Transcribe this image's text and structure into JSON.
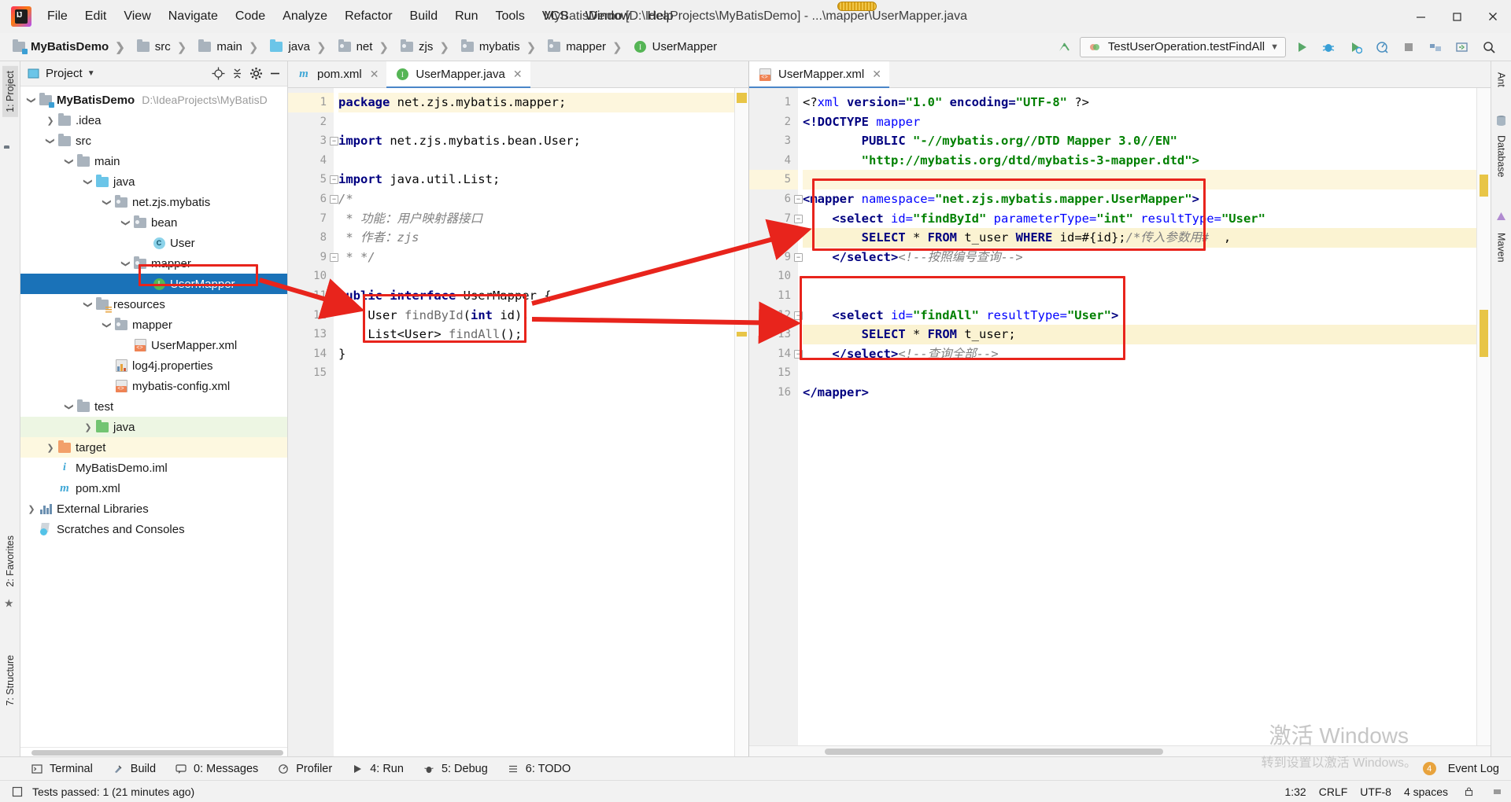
{
  "titlebar": {
    "window_title": "MyBatisDemo [D:\\IdeaProjects\\MyBatisDemo] - ...\\mapper\\UserMapper.java",
    "menus": [
      "File",
      "Edit",
      "View",
      "Navigate",
      "Code",
      "Analyze",
      "Refactor",
      "Build",
      "Run",
      "Tools",
      "VCS",
      "Window",
      "Help"
    ],
    "minimize": "—",
    "maximize": "❐",
    "close": "✕"
  },
  "navbar": {
    "crumbs": [
      {
        "label": "MyBatisDemo",
        "icon": "module-folder-icon"
      },
      {
        "label": "src",
        "icon": "folder-icon"
      },
      {
        "label": "main",
        "icon": "folder-icon"
      },
      {
        "label": "java",
        "icon": "source-folder-icon"
      },
      {
        "label": "net",
        "icon": "package-icon"
      },
      {
        "label": "zjs",
        "icon": "package-icon"
      },
      {
        "label": "mybatis",
        "icon": "package-icon"
      },
      {
        "label": "mapper",
        "icon": "package-icon"
      },
      {
        "label": "UserMapper",
        "icon": "interface-icon"
      }
    ],
    "run_config": "TestUserOperation.testFindAll",
    "buttons": [
      "run-button",
      "debug-button",
      "run-coverage-button",
      "profile-button",
      "stop-button",
      "build-button",
      "update-button",
      "search-button"
    ]
  },
  "leftrail": {
    "tabs": [
      "1: Project",
      "2: Favorites",
      "7: Structure"
    ]
  },
  "rightrail": {
    "tabs": [
      "Ant",
      "Database",
      "Maven"
    ]
  },
  "project_panel": {
    "title": "Project",
    "toolbar_icons": [
      "locate-icon",
      "collapse-all-icon",
      "settings-icon",
      "hide-icon"
    ],
    "tree": [
      {
        "depth": 0,
        "arrow": "down",
        "label": "MyBatisDemo",
        "path": "D:\\IdeaProjects\\MyBatisD",
        "icon": "module-folder-icon",
        "bold": true
      },
      {
        "depth": 1,
        "arrow": "right",
        "label": ".idea",
        "icon": "folder-icon"
      },
      {
        "depth": 1,
        "arrow": "down",
        "label": "src",
        "icon": "folder-icon"
      },
      {
        "depth": 2,
        "arrow": "down",
        "label": "main",
        "icon": "folder-icon"
      },
      {
        "depth": 3,
        "arrow": "down",
        "label": "java",
        "icon": "source-folder-icon"
      },
      {
        "depth": 4,
        "arrow": "down",
        "label": "net.zjs.mybatis",
        "icon": "package-icon"
      },
      {
        "depth": 5,
        "arrow": "down",
        "label": "bean",
        "icon": "package-icon"
      },
      {
        "depth": 6,
        "arrow": "none",
        "label": "User",
        "icon": "class-icon"
      },
      {
        "depth": 5,
        "arrow": "down",
        "label": "mapper",
        "icon": "package-icon"
      },
      {
        "depth": 6,
        "arrow": "none",
        "label": "UserMapper",
        "icon": "interface-icon",
        "selected": true
      },
      {
        "depth": 3,
        "arrow": "down",
        "label": "resources",
        "icon": "resources-folder-icon"
      },
      {
        "depth": 4,
        "arrow": "down",
        "label": "mapper",
        "icon": "package-icon"
      },
      {
        "depth": 5,
        "arrow": "none",
        "label": "UserMapper.xml",
        "icon": "xml-file-icon"
      },
      {
        "depth": 4,
        "arrow": "none",
        "label": "log4j.properties",
        "icon": "properties-file-icon"
      },
      {
        "depth": 4,
        "arrow": "none",
        "label": "mybatis-config.xml",
        "icon": "xml-file-icon"
      },
      {
        "depth": 2,
        "arrow": "down",
        "label": "test",
        "icon": "folder-icon"
      },
      {
        "depth": 3,
        "arrow": "right",
        "label": "java",
        "icon": "test-source-folder-icon",
        "green": true
      },
      {
        "depth": 1,
        "arrow": "right",
        "label": "target",
        "icon": "excluded-folder-icon",
        "yellowish": true
      },
      {
        "depth": 1,
        "arrow": "none",
        "label": "MyBatisDemo.iml",
        "icon": "iml-file-icon"
      },
      {
        "depth": 1,
        "arrow": "none",
        "label": "pom.xml",
        "icon": "maven-file-icon"
      },
      {
        "depth": 0,
        "arrow": "right",
        "label": "External Libraries",
        "icon": "libraries-icon"
      },
      {
        "depth": 0,
        "arrow": "none",
        "label": "Scratches and Consoles",
        "icon": "scratches-icon"
      }
    ]
  },
  "editor_left": {
    "tabs": [
      {
        "label": "pom.xml",
        "icon": "maven-file-icon",
        "active": false
      },
      {
        "label": "UserMapper.java",
        "icon": "interface-icon",
        "active": true
      }
    ],
    "lines": [
      {
        "n": 1,
        "hl": true,
        "fold": null,
        "parts": [
          {
            "t": "package ",
            "c": "kw"
          },
          {
            "t": "net.zjs.mybatis.mapper;",
            "c": "plain"
          }
        ]
      },
      {
        "n": 2,
        "hl": false,
        "fold": null,
        "parts": []
      },
      {
        "n": 3,
        "hl": false,
        "fold": "minus",
        "parts": [
          {
            "t": "import ",
            "c": "kw"
          },
          {
            "t": "net.zjs.mybatis.bean.User;",
            "c": "plain"
          }
        ]
      },
      {
        "n": 4,
        "hl": false,
        "fold": null,
        "parts": []
      },
      {
        "n": 5,
        "hl": false,
        "fold": "minus",
        "parts": [
          {
            "t": "import ",
            "c": "kw"
          },
          {
            "t": "java.util.List;",
            "c": "plain"
          }
        ]
      },
      {
        "n": 6,
        "hl": false,
        "fold": "minus",
        "parts": [
          {
            "t": "/*",
            "c": "doc"
          }
        ]
      },
      {
        "n": 7,
        "hl": false,
        "fold": null,
        "parts": [
          {
            "t": " * 功能：用户映射器接口",
            "c": "doc"
          }
        ]
      },
      {
        "n": 8,
        "hl": false,
        "fold": null,
        "parts": [
          {
            "t": " * 作者：zjs",
            "c": "doc"
          }
        ]
      },
      {
        "n": 9,
        "hl": false,
        "fold": "minus",
        "parts": [
          {
            "t": " * */",
            "c": "doc"
          }
        ]
      },
      {
        "n": 10,
        "hl": false,
        "fold": null,
        "parts": []
      },
      {
        "n": 11,
        "hl": false,
        "fold": null,
        "parts": [
          {
            "t": "public interface ",
            "c": "kw"
          },
          {
            "t": "UserMapper {",
            "c": "plain"
          }
        ]
      },
      {
        "n": 12,
        "hl": false,
        "fold": null,
        "parts": [
          {
            "t": "    User ",
            "c": "plain"
          },
          {
            "t": "findById",
            "c": "meth"
          },
          {
            "t": "(",
            "c": "plain"
          },
          {
            "t": "int",
            "c": "kw"
          },
          {
            "t": " id);",
            "c": "plain"
          }
        ]
      },
      {
        "n": 13,
        "hl": false,
        "fold": null,
        "parts": [
          {
            "t": "    List<User> ",
            "c": "plain"
          },
          {
            "t": "findAll",
            "c": "meth"
          },
          {
            "t": "();",
            "c": "plain"
          }
        ]
      },
      {
        "n": 14,
        "hl": false,
        "fold": null,
        "parts": [
          {
            "t": "}",
            "c": "plain"
          }
        ]
      },
      {
        "n": 15,
        "hl": false,
        "fold": null,
        "parts": []
      }
    ]
  },
  "editor_right": {
    "tabs": [
      {
        "label": "UserMapper.xml",
        "icon": "xml-file-icon",
        "active": true
      }
    ],
    "lines": [
      {
        "n": 1,
        "hl": false,
        "fold": null,
        "parts": [
          {
            "t": "<?",
            "c": "plain"
          },
          {
            "t": "xml ",
            "c": "attr"
          },
          {
            "t": "version=",
            "c": "tagn"
          },
          {
            "t": "\"1.0\"",
            "c": "str"
          },
          {
            "t": " encoding=",
            "c": "tagn"
          },
          {
            "t": "\"UTF-8\"",
            "c": "str"
          },
          {
            "t": " ?>",
            "c": "plain"
          }
        ]
      },
      {
        "n": 2,
        "hl": false,
        "fold": null,
        "parts": [
          {
            "t": "<!DOCTYPE ",
            "c": "tagn"
          },
          {
            "t": "mapper",
            "c": "attr"
          }
        ]
      },
      {
        "n": 3,
        "hl": false,
        "fold": null,
        "parts": [
          {
            "t": "        PUBLIC ",
            "c": "tagn"
          },
          {
            "t": "\"-//mybatis.org//DTD Mapper 3.0//EN\"",
            "c": "str"
          }
        ]
      },
      {
        "n": 4,
        "hl": false,
        "fold": null,
        "parts": [
          {
            "t": "        ",
            "c": "plain"
          },
          {
            "t": "\"http://mybatis.org/dtd/mybatis-3-mapper.dtd\">",
            "c": "str"
          }
        ]
      },
      {
        "n": 5,
        "hl": true,
        "fold": null,
        "parts": []
      },
      {
        "n": 6,
        "hl": false,
        "fold": "minus",
        "parts": [
          {
            "t": "<mapper ",
            "c": "tagn"
          },
          {
            "t": "namespace=",
            "c": "attr"
          },
          {
            "t": "\"net.zjs.mybatis.mapper.UserMapper\"",
            "c": "str"
          },
          {
            "t": ">",
            "c": "tagn"
          }
        ]
      },
      {
        "n": 7,
        "hl": false,
        "fold": "minus",
        "parts": [
          {
            "t": "    <select ",
            "c": "tagn"
          },
          {
            "t": "id=",
            "c": "attr"
          },
          {
            "t": "\"findById\"",
            "c": "str"
          },
          {
            "t": " parameterType=",
            "c": "attr"
          },
          {
            "t": "\"int\"",
            "c": "str"
          },
          {
            "t": " resultType=",
            "c": "attr"
          },
          {
            "t": "\"User\"",
            "c": "str"
          }
        ]
      },
      {
        "n": 8,
        "hl": false,
        "fold": null,
        "sql": true,
        "parts": [
          {
            "t": "        SELECT ",
            "c": "kw"
          },
          {
            "t": "* ",
            "c": "plain"
          },
          {
            "t": "FROM ",
            "c": "kw"
          },
          {
            "t": "t_user ",
            "c": "plain"
          },
          {
            "t": "WHERE ",
            "c": "kw"
          },
          {
            "t": "id=#{id};",
            "c": "plain"
          },
          {
            "t": "/*传入参数用#",
            "c": "cmt"
          },
          {
            "t": "  ,",
            "c": "plain"
          }
        ]
      },
      {
        "n": 9,
        "hl": false,
        "fold": "minus",
        "parts": [
          {
            "t": "    </select>",
            "c": "tagn"
          },
          {
            "t": "<!--按照编号查询-->",
            "c": "cmt"
          }
        ]
      },
      {
        "n": 10,
        "hl": false,
        "fold": null,
        "parts": []
      },
      {
        "n": 11,
        "hl": false,
        "fold": null,
        "parts": []
      },
      {
        "n": 12,
        "hl": false,
        "fold": "minus",
        "parts": [
          {
            "t": "    <select ",
            "c": "tagn"
          },
          {
            "t": "id=",
            "c": "attr"
          },
          {
            "t": "\"findAll\"",
            "c": "str"
          },
          {
            "t": " resultType=",
            "c": "attr"
          },
          {
            "t": "\"User\"",
            "c": "str"
          },
          {
            "t": ">",
            "c": "tagn"
          }
        ]
      },
      {
        "n": 13,
        "hl": false,
        "fold": null,
        "sql": true,
        "parts": [
          {
            "t": "        SELECT ",
            "c": "kw"
          },
          {
            "t": "* ",
            "c": "plain"
          },
          {
            "t": "FROM ",
            "c": "kw"
          },
          {
            "t": "t_user;",
            "c": "plain"
          }
        ]
      },
      {
        "n": 14,
        "hl": false,
        "fold": "minus",
        "parts": [
          {
            "t": "    </select>",
            "c": "tagn"
          },
          {
            "t": "<!--查询全部-->",
            "c": "cmt"
          }
        ]
      },
      {
        "n": 15,
        "hl": false,
        "fold": null,
        "parts": []
      },
      {
        "n": 16,
        "hl": false,
        "fold": null,
        "parts": [
          {
            "t": "</mapper>",
            "c": "tagn"
          }
        ]
      }
    ]
  },
  "bottom_toolbar": {
    "buttons": [
      {
        "label": "Terminal",
        "icon": "terminal-icon"
      },
      {
        "label": "Build",
        "icon": "build-icon"
      },
      {
        "label": "0: Messages",
        "icon": "messages-icon"
      },
      {
        "label": "Profiler",
        "icon": "profiler-icon"
      },
      {
        "label": "4: Run",
        "icon": "run-icon"
      },
      {
        "label": "5: Debug",
        "icon": "debug-icon"
      },
      {
        "label": "6: TODO",
        "icon": "todo-icon"
      }
    ],
    "event_log": "Event Log",
    "event_badge": "4"
  },
  "status_bar": {
    "message": "Tests passed: 1 (21 minutes ago)",
    "caret": "1:32",
    "line_sep": "CRLF",
    "encoding": "UTF-8",
    "indent": "4 spaces"
  },
  "watermark": {
    "line1": "激活 Windows",
    "line2": "转到设置以激活 Windows。"
  },
  "colors": {
    "selection_blue": "#1a72b8",
    "annotation_red": "#e8241c",
    "highlight_yellow": "#fdf6dd",
    "sql_highlight": "#fbf3d2",
    "accent_green": "#55b555"
  }
}
